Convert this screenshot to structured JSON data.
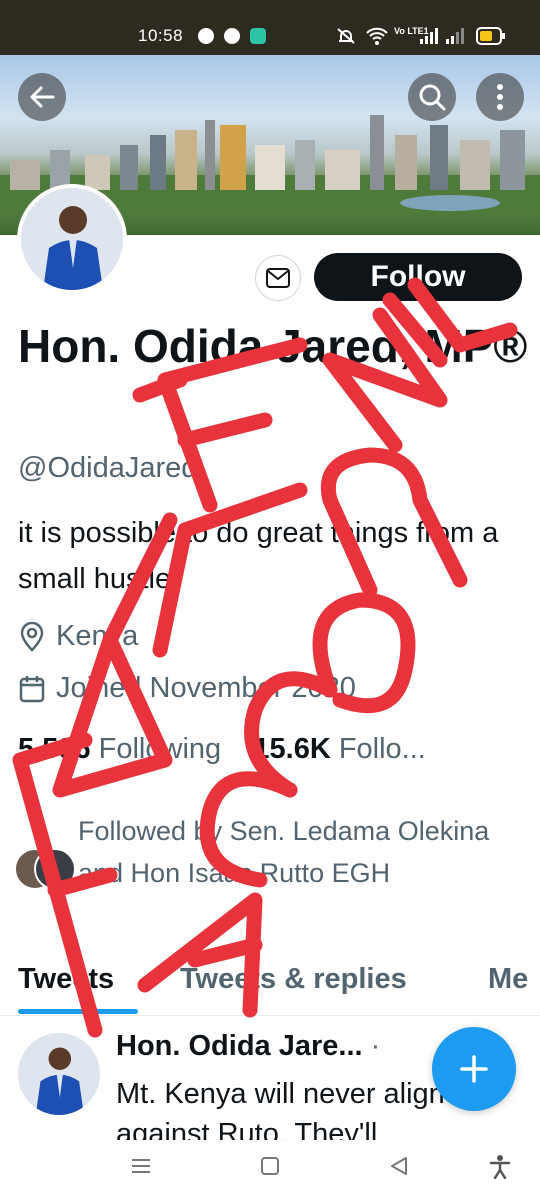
{
  "status_bar": {
    "time": "10:58",
    "network": "Vo LTE1"
  },
  "banner": {
    "description_icon": "city-skyline"
  },
  "profile": {
    "name": "Hon. Odida Jared, MP®",
    "handle": "@OdidaJared",
    "bio": "it is possible to do great things from a small hustle.",
    "location": "Kenya",
    "joined": "Joined November 2020",
    "following_count": "5,596",
    "following_label": "Following",
    "followers_count": "15.6K",
    "followers_label": "Follo..."
  },
  "actions": {
    "follow_label": "Follow"
  },
  "followed_by": "Followed by Sen. Ledama Olekina and Hon Isaac Rutto EGH",
  "tabs": [
    {
      "label": "Tweets"
    },
    {
      "label": "Tweets & replies"
    },
    {
      "label": "Me"
    }
  ],
  "tweet": {
    "author": "Hon. Odida Jare...",
    "separator": "·",
    "text": "Mt. Kenya will never align against Ruto. They'll"
  },
  "watermark": {
    "line1": "FAKE",
    "line2": "ACCOUNT",
    "color": "#e8323c"
  },
  "colors": {
    "accent": "#1d9bf0",
    "text": "#0f1419",
    "muted": "#536471"
  }
}
